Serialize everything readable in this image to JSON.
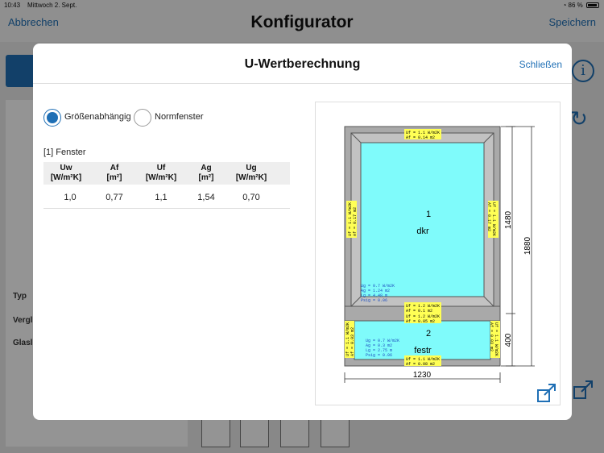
{
  "status_bar": {
    "time": "10:43",
    "date": "Mittwoch 2. Sept.",
    "battery": "86 %"
  },
  "app_header": {
    "cancel_label": "Abbrechen",
    "title": "Konfigurator",
    "save_label": "Speichern"
  },
  "background": {
    "labels": [
      "Typ",
      "Vergl",
      "Glasl"
    ]
  },
  "modal": {
    "title": "U-Wertberechnung",
    "close_label": "Schließen",
    "radio_options": [
      {
        "label": "Größenabhängig",
        "selected": true
      },
      {
        "label": "Normfenster",
        "selected": false
      }
    ],
    "section_title": "[1] Fenster",
    "table": {
      "columns": [
        {
          "name": "Uw",
          "unit": "[W/m²K]"
        },
        {
          "name": "Af",
          "unit": "[m²]"
        },
        {
          "name": "Uf",
          "unit": "[W/m²K]"
        },
        {
          "name": "Ag",
          "unit": "[m²]"
        },
        {
          "name": "Ug",
          "unit": "[W/m²K]"
        }
      ],
      "rows": [
        [
          "1,0",
          "0,77",
          "1,1",
          "1,54",
          "0,70"
        ]
      ]
    },
    "drawing": {
      "width_dim": "1230",
      "height_total_dim": "1880",
      "height_upper_dim": "1480",
      "height_lower_dim": "400",
      "glass_color": "#7ffbfb",
      "frame_color": "#a9a9a9",
      "label_color": "#ffff55",
      "panes": [
        {
          "number": "1",
          "type": "dkr",
          "glass_info": [
            "Ug = 0.7 W/m2K",
            "Ag = 1.24 m2",
            "Lg = 4.48 m",
            "Psig = 0.06"
          ]
        },
        {
          "number": "2",
          "type": "festr",
          "glass_info": [
            "Ug = 0.7 W/m2K",
            "Ag = 0.3 m2",
            "Lg = 2.75 m",
            "Psig = 0.06"
          ]
        }
      ],
      "frame_labels": {
        "top": [
          "Uf = 1.1 W/m2K",
          "Af = 0.14 m2"
        ],
        "transom_upper": [
          "Uf = 1.2 W/m2K",
          "Af = 0.1 m2"
        ],
        "transom_lower": [
          "Uf = 1.2 W/m2K",
          "Af = 0.05 m2"
        ],
        "bottom": [
          "Uf = 1.1 W/m2K",
          "Af = 0.08 m2"
        ],
        "side_upper": [
          "Uf = 1.1 W/m2K",
          "Af = 0.17 m2"
        ],
        "side_lower": [
          "Uf = 1.1 W/m2K",
          "Af = 0.03 m2"
        ]
      }
    }
  }
}
